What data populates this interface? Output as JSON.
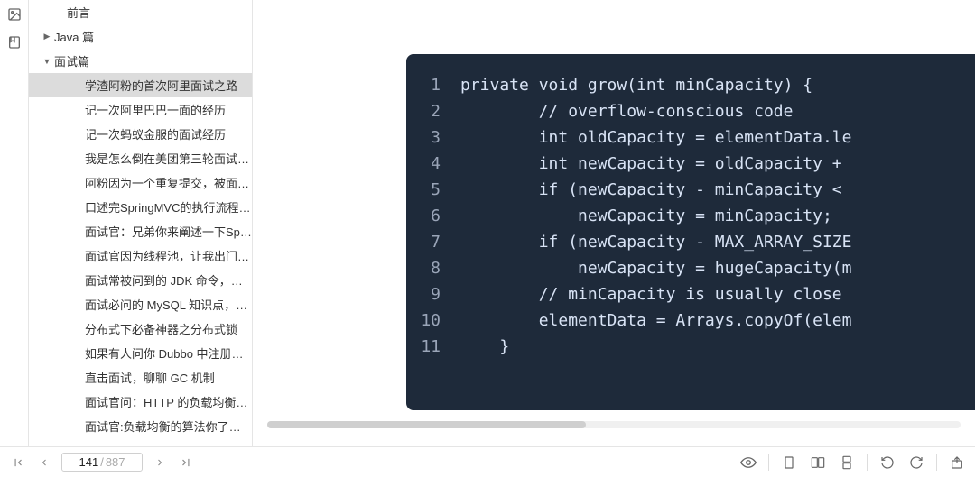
{
  "sidebar": {
    "items": [
      {
        "label": "前言",
        "level": 0,
        "expandable": false,
        "expanded": false,
        "selected": false
      },
      {
        "label": "Java 篇",
        "level": 1,
        "expandable": true,
        "expanded": false,
        "selected": false
      },
      {
        "label": "面试篇",
        "level": 1,
        "expandable": true,
        "expanded": true,
        "selected": false
      },
      {
        "label": "学渣阿粉的首次阿里面试之路",
        "level": 2,
        "expandable": false,
        "expanded": false,
        "selected": true
      },
      {
        "label": "记一次阿里巴巴一面的经历",
        "level": 2,
        "expandable": false,
        "expanded": false,
        "selected": false
      },
      {
        "label": "记一次蚂蚁金服的面试经历",
        "level": 2,
        "expandable": false,
        "expanded": false,
        "selected": false
      },
      {
        "label": "我是怎么倒在美团第三轮面试之下的",
        "level": 2,
        "expandable": false,
        "expanded": false,
        "selected": false
      },
      {
        "label": "阿粉因为一个重复提交，被面试官…",
        "level": 2,
        "expandable": false,
        "expanded": false,
        "selected": false
      },
      {
        "label": "口述完SpringMVC的执行流程后，…",
        "level": 2,
        "expandable": false,
        "expanded": false,
        "selected": false
      },
      {
        "label": "面试官：兄弟你来阐述一下Spring…",
        "level": 2,
        "expandable": false,
        "expanded": false,
        "selected": false
      },
      {
        "label": "面试官因为线程池，让我出门左拐！",
        "level": 2,
        "expandable": false,
        "expanded": false,
        "selected": false
      },
      {
        "label": "面试常被问到的 JDK 命令，你知…",
        "level": 2,
        "expandable": false,
        "expanded": false,
        "selected": false
      },
      {
        "label": "面试必问的 MySQL 知识点，你还…",
        "level": 2,
        "expandable": false,
        "expanded": false,
        "selected": false
      },
      {
        "label": "分布式下必备神器之分布式锁",
        "level": 2,
        "expandable": false,
        "expanded": false,
        "selected": false
      },
      {
        "label": "如果有人问你 Dubbo 中注册中心…",
        "level": 2,
        "expandable": false,
        "expanded": false,
        "selected": false
      },
      {
        "label": "直击面试，聊聊 GC 机制",
        "level": 2,
        "expandable": false,
        "expanded": false,
        "selected": false
      },
      {
        "label": "面试官问：HTTP 的负载均衡你了…",
        "level": 2,
        "expandable": false,
        "expanded": false,
        "selected": false
      },
      {
        "label": "面试官:负载均衡的算法你了解不?",
        "level": 2,
        "expandable": false,
        "expanded": false,
        "selected": false
      }
    ]
  },
  "code": {
    "lines": [
      "private void grow(int minCapacity) {",
      "        // overflow-conscious code",
      "        int oldCapacity = elementData.le",
      "        int newCapacity = oldCapacity + ",
      "        if (newCapacity - minCapacity < ",
      "            newCapacity = minCapacity;",
      "        if (newCapacity - MAX_ARRAY_SIZE",
      "            newCapacity = hugeCapacity(m",
      "        // minCapacity is usually close ",
      "        elementData = Arrays.copyOf(elem",
      "    }"
    ]
  },
  "pager": {
    "current": "141",
    "total": "887"
  }
}
